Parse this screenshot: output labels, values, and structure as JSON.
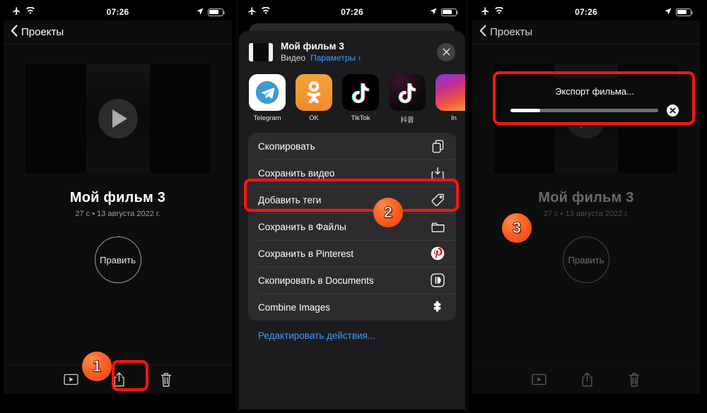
{
  "status_bar": {
    "airplane_icon": "airplane-mode-icon",
    "wifi_icon": "wifi-icon",
    "time": "07:26",
    "location_icon": "location-arrow-icon",
    "battery_icon": "battery-icon",
    "battery_level": 72
  },
  "panel1": {
    "nav": {
      "back_label": "Проекты",
      "back_icon": "chevron-left-icon"
    },
    "video": {
      "play_icon": "play-button-icon"
    },
    "title": "Мой фильм 3",
    "subtitle": "27 с • 13 августа 2022 г.",
    "edit_button": "Править",
    "toolbar": {
      "play_icon": "play-rect-icon",
      "share_icon": "share-upload-icon",
      "delete_icon": "trash-icon"
    },
    "badge": "1"
  },
  "panel2": {
    "sheet_header": {
      "file_name": "Мой фильм 3",
      "file_type": "Видео",
      "options_link": "Параметры",
      "options_chevron": "›",
      "close_icon": "close-x-icon"
    },
    "apps": [
      {
        "label": "Telegram",
        "icon": "telegram-icon"
      },
      {
        "label": "OK",
        "icon": "odnoklassniki-icon"
      },
      {
        "label": "TikTok",
        "icon": "tiktok-icon"
      },
      {
        "label": "抖音",
        "icon": "douyin-icon"
      },
      {
        "label": "In",
        "icon": "instagram-icon"
      }
    ],
    "actions": [
      {
        "label": "Скопировать",
        "icon": "copy-icon"
      },
      {
        "label": "Сохранить видео",
        "icon": "save-download-icon"
      },
      {
        "label": "Добавить теги",
        "icon": "tag-icon"
      },
      {
        "label": "Сохранить в Файлы",
        "icon": "folder-icon"
      },
      {
        "label": "Сохранить в Pinterest",
        "icon": "pinterest-icon"
      },
      {
        "label": "Скопировать в Documents",
        "icon": "documents-app-icon"
      },
      {
        "label": "Combine Images",
        "icon": "puzzle-piece-icon"
      }
    ],
    "edit_actions": "Редактировать действия...",
    "badge": "2"
  },
  "panel3": {
    "nav": {
      "back_label": "Проекты",
      "back_icon": "chevron-left-icon"
    },
    "export": {
      "title": "Экспорт фильма...",
      "progress_percent": 20,
      "cancel_icon": "cancel-x-icon"
    },
    "title": "Мой фильм 3",
    "subtitle": "27 с • 13 августа 2022 г.",
    "edit_button": "Править",
    "toolbar": {
      "play_icon": "play-rect-icon",
      "share_icon": "share-upload-icon",
      "delete_icon": "trash-icon"
    },
    "badge": "3"
  },
  "colors": {
    "highlight_red": "#fd1412",
    "badge_orange": "#fb5f22",
    "link_blue": "#3e9bff",
    "sheet_bg": "#1c1c1e",
    "action_bg": "#2c2c2e"
  }
}
